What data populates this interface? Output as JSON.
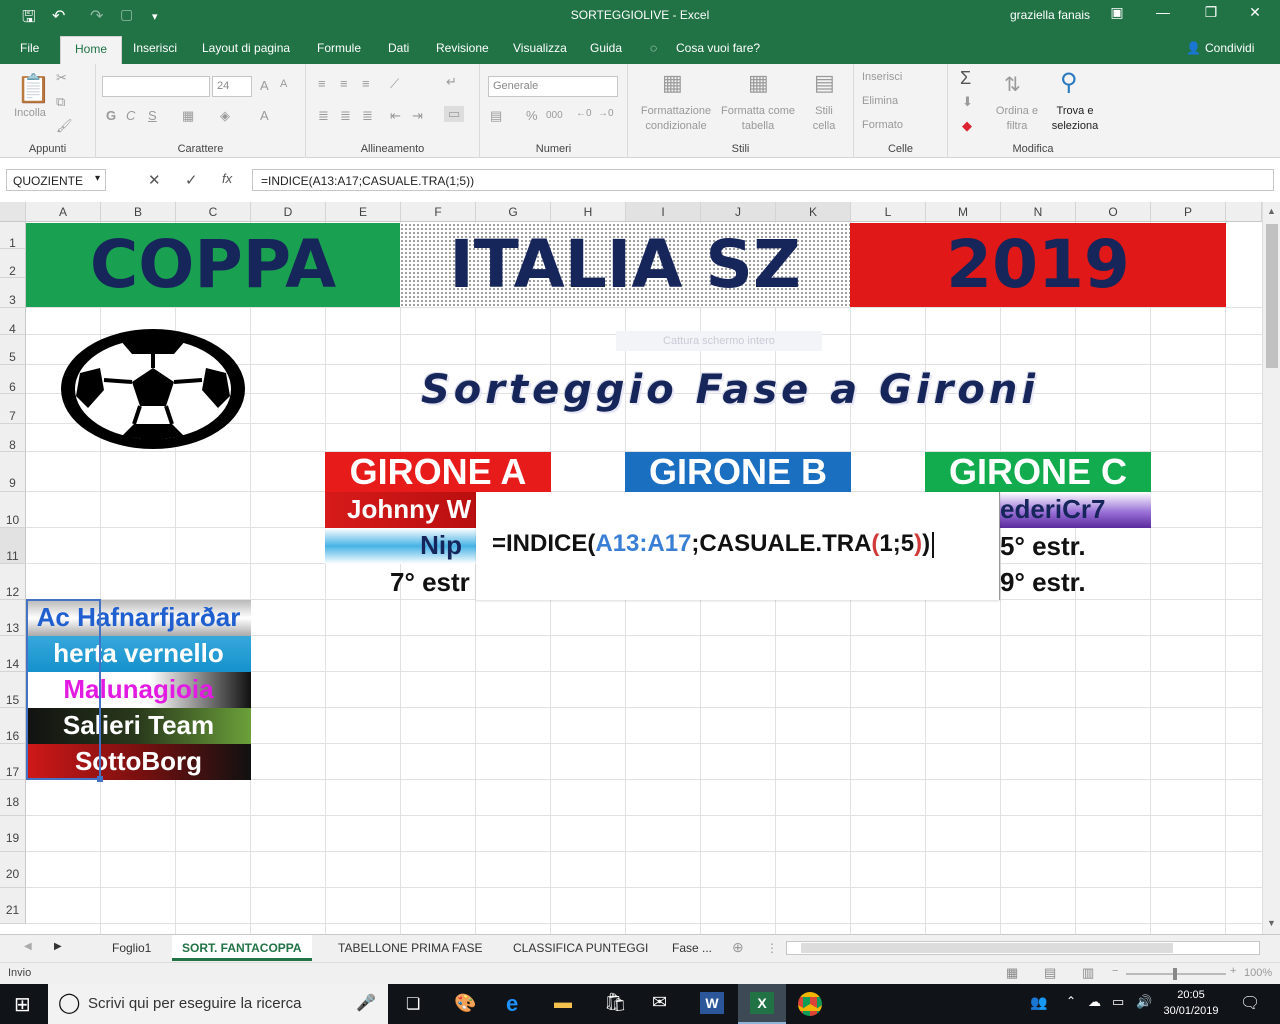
{
  "window": {
    "title": "SORTEGGIOLIVE  -  Excel",
    "user": "graziella fanais",
    "save_icon": "save-icon",
    "undo_icon": "undo-icon",
    "redo_icon": "redo-icon"
  },
  "ribbon_tabs": [
    "File",
    "Home",
    "Inserisci",
    "Layout di pagina",
    "Formule",
    "Dati",
    "Revisione",
    "Visualizza",
    "Guida"
  ],
  "active_tab": "Home",
  "tell_me": "Cosa vuoi fare?",
  "share": "Condividi",
  "ribbon": {
    "clipboard": {
      "label": "Appunti",
      "paste": "Incolla"
    },
    "font": {
      "label": "Carattere",
      "size": "24",
      "bold": "G",
      "italic": "C",
      "underline": "S"
    },
    "alignment": {
      "label": "Allineamento"
    },
    "number": {
      "label": "Numeri",
      "format": "Generale",
      "percent": "%",
      "thousands": "000"
    },
    "styles": {
      "label": "Stili",
      "conditional": "Formattazione condizionale",
      "table": "Formatta come tabella",
      "cell_styles": "Stili cella"
    },
    "cells": {
      "label": "Celle",
      "insert": "Inserisci",
      "delete": "Elimina",
      "format": "Formato"
    },
    "editing": {
      "label": "Modifica",
      "sort": "Ordina e filtra",
      "find": "Trova e seleziona"
    }
  },
  "formula_bar": {
    "name_box": "QUOZIENTE",
    "formula": "=INDICE(A13:A17;CASUALE.TRA(1;5))",
    "cancel": "✕",
    "enter": "✓",
    "fx": "fx"
  },
  "columns": [
    "A",
    "B",
    "C",
    "D",
    "E",
    "F",
    "G",
    "H",
    "I",
    "J",
    "K",
    "L",
    "M",
    "N",
    "O",
    "P"
  ],
  "rows": [
    "1",
    "2",
    "3",
    "4",
    "5",
    "6",
    "7",
    "8",
    "9",
    "10",
    "11",
    "12",
    "13",
    "14",
    "15",
    "16",
    "17",
    "18",
    "19",
    "20",
    "21"
  ],
  "sheet": {
    "banner": [
      "COPPA",
      "ITALIA SZ",
      "2019"
    ],
    "subtitle": "Sorteggio Fase a Gironi",
    "ghost_text": "Cattura schermo intero",
    "groups": [
      {
        "name": "GIRONE A",
        "color": "#e81b1b"
      },
      {
        "name": "GIRONE B",
        "color": "#1a6fc0"
      },
      {
        "name": "GIRONE C",
        "color": "#12ab4e"
      }
    ],
    "row10": {
      "a": "Johnny W",
      "c": "ederiCr7"
    },
    "row11": {
      "a": "Nip",
      "c": "5° estr."
    },
    "row12": {
      "a": "7° estr",
      "c": "9° estr."
    },
    "teams": [
      {
        "name": "Ac Hafnarfjarðar",
        "color": "#1f5fd0"
      },
      {
        "name": "herta vernello",
        "color": "#ffffff"
      },
      {
        "name": "Malunagioia",
        "color": "#e21ae2"
      },
      {
        "name": "Salieri Team",
        "color": "#ffffff"
      },
      {
        "name": "SottoBorg",
        "color": "#ffffff"
      }
    ],
    "edit_formula": {
      "prefix": "=INDICE(",
      "range": "A13:A17",
      "sep": ";CASUALE.TRA",
      "lparen": "(",
      "args": "1;5",
      "rparen": ")",
      "close": ")"
    }
  },
  "sheet_tabs": [
    "Foglio1",
    "SORT. FANTACOPPA",
    "TABELLONE PRIMA FASE",
    "CLASSIFICA PUNTEGGI",
    "Fase ..."
  ],
  "active_sheet": "SORT. FANTACOPPA",
  "status": {
    "mode": "Invio",
    "zoom": "100%"
  },
  "taskbar": {
    "search_placeholder": "Scrivi qui per eseguire la ricerca",
    "time": "20:05",
    "date": "30/01/2019"
  }
}
